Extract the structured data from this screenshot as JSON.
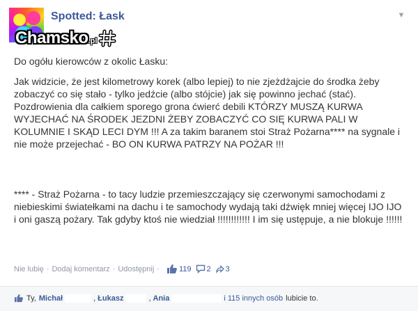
{
  "post": {
    "page_name": "Spotted: Łask",
    "watermark": "Chamsko",
    "watermark_suffix": ".pl",
    "paragraphs": [
      "Do ogółu kierowców z okolic Łasku:",
      "Jak widzicie, że jest kilometrowy korek (albo lepiej) to nie zjeżdżajcie do środka żeby zobaczyć co się stało - tylko jedźcie (albo stójcie) jak się powinno jechać (stać). Pozdrowienia dla całkiem sporego grona ćwierć debili KTÓRZY MUSZĄ KURWA WYJECHAĆ NA ŚRODEK JEZDNI ŻEBY ZOBACZYĆ CO SIĘ KURWA PALI W KOLUMNIE I SKĄD LECI DYM !!! A za takim baranem stoi Straż Pożarna**** na sygnale i nie może przejechać - BO ON KURWA PATRZY NA POŻAR !!!",
      "**** - Straż Pożarna - to tacy ludzie przemieszczający się czerwonymi samochodami z niebieskimi światełkami na dachu i te samochody wydają taki dźwięk mniej więcej IJO IJO i oni gaszą pożary. Tak gdyby ktoś nie wiedział !!!!!!!!!!!! I im się ustępuje, a nie blokuje !!!!!!"
    ]
  },
  "actions": {
    "unlike": "Nie lubię",
    "comment": "Dodaj komentarz",
    "share": "Udostępnij",
    "separator": "·",
    "likes_count": "119",
    "comments_count": "2",
    "shares_count": "3"
  },
  "likes_summary": {
    "you": "Ty,",
    "name1": "Michał",
    "name2": "Łukasz",
    "name3": "Ania",
    "comma": ",",
    "others_link": "i 115 innych osób",
    "suffix": "lubicie to."
  },
  "icons": {
    "dropdown": "chevron-down-icon",
    "like": "thumbs-up-icon",
    "comment": "comment-bubble-icon",
    "share": "share-arrow-icon"
  },
  "colors": {
    "link": "#3b5998",
    "muted": "#9197a3",
    "likes_bg": "#f6f7f8"
  }
}
